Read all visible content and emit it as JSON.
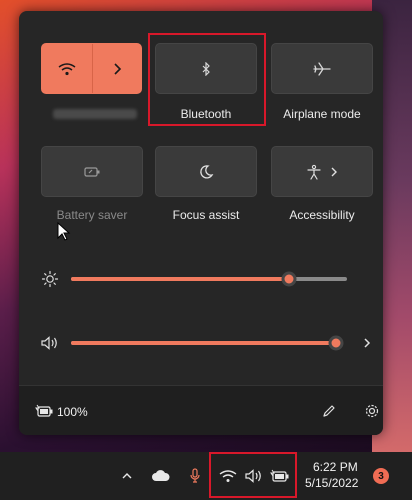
{
  "quick_settings": {
    "tiles": {
      "wifi": {
        "icon": "wifi-icon",
        "expand_icon": "chevron-right-icon",
        "active": true
      },
      "bluetooth": {
        "label": "Bluetooth",
        "icon": "bluetooth-icon"
      },
      "airplane": {
        "label": "Airplane mode",
        "icon": "airplane-icon"
      },
      "battery_saver": {
        "label": "Battery saver",
        "icon": "battery-saver-icon",
        "disabled": true
      },
      "focus_assist": {
        "label": "Focus assist",
        "icon": "moon-icon"
      },
      "accessibility": {
        "label": "Accessibility",
        "icon": "accessibility-icon",
        "expand_icon": "chevron-right-icon"
      }
    },
    "brightness": {
      "icon": "sun-icon",
      "level": 0.79
    },
    "volume": {
      "icon": "speaker-icon",
      "level": 0.99,
      "expand_icon": "chevron-right-icon"
    },
    "footer": {
      "battery_icon": "battery-charging-icon",
      "battery_percent": "100%",
      "edit_icon": "pencil-icon",
      "settings_icon": "gear-icon"
    }
  },
  "taskbar": {
    "icons": [
      "chevron-up-icon",
      "cloud-icon",
      "microphone-icon",
      "wifi-icon",
      "speaker-icon",
      "battery-icon"
    ],
    "time": "6:22 PM",
    "date": "5/15/2022",
    "notification_count": "3"
  },
  "colors": {
    "accent": "#f07a5e",
    "panel": "#262626",
    "tile": "#3a3a3a",
    "highlight": "#d8182a",
    "taskbar": "#202020"
  }
}
